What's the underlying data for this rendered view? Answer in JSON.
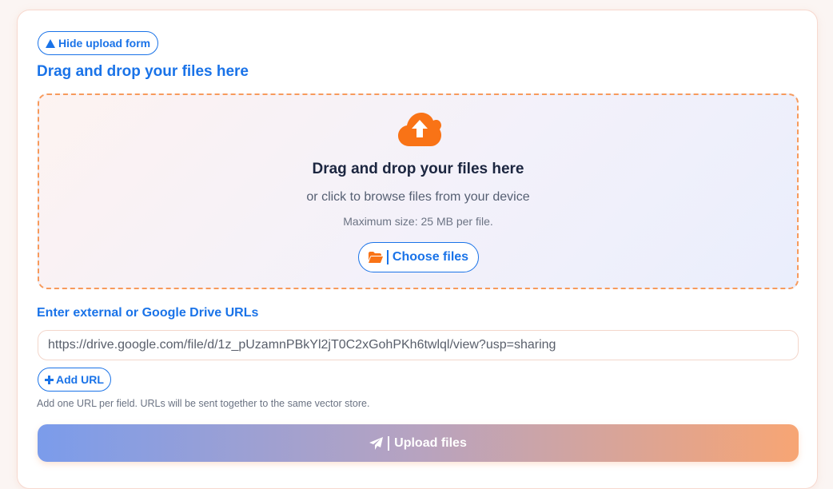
{
  "toggle": {
    "label": "Hide upload form",
    "icon": "triangle-up-icon"
  },
  "upload": {
    "section_title": "Drag and drop your files here",
    "dropzone": {
      "icon": "cloud-upload-icon",
      "title": "Drag and drop your files here",
      "subtitle": "or click to browse files from your device",
      "max_size": "Maximum size: 25 MB per file.",
      "choose_label": "Choose files",
      "choose_icon": "folder-open-icon"
    }
  },
  "urls": {
    "label": "Enter external or Google Drive URLs",
    "value": "https://drive.google.com/file/d/1z_pUzamnPBkYl2jT0C2xGohPKh6twlql/view?usp=sharing",
    "add_label": "Add URL",
    "add_icon": "plus-icon",
    "hint": "Add one URL per field. URLs will be sent together to the same vector store."
  },
  "submit": {
    "label": "Upload files",
    "icon": "paper-plane-icon"
  },
  "colors": {
    "accent": "#1a73e8",
    "orange": "#f97316",
    "dashed_border": "#f79a5c",
    "gradient_start": "#7b9ceb",
    "gradient_end": "#f7a574"
  }
}
